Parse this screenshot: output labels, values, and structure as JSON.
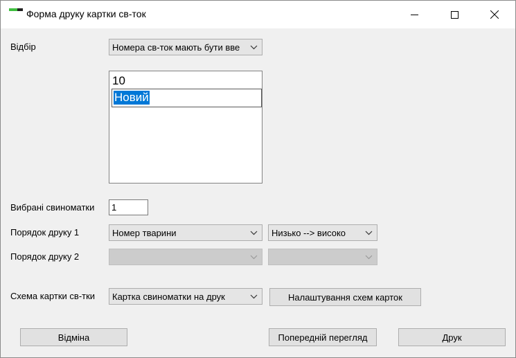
{
  "window": {
    "title": "Форма друку картки св-ток"
  },
  "form": {
    "selection_label": "Відбір",
    "selection_value": "Номера св-ток мають бути вве",
    "list_items": [
      "10"
    ],
    "list_edit_value": "Новий",
    "selected_label": "Вибрані свиноматки",
    "selected_value": "1",
    "order1_label": "Порядок друку 1",
    "order1_field": "Номер тварини",
    "order1_direction": "Низько --> високо",
    "order2_label": "Порядок друку 2",
    "order2_field": "",
    "order2_direction": "",
    "scheme_label": "Схема картки св-тки",
    "scheme_value": "Картка свиноматки на друк",
    "scheme_settings_button": "Налаштування схем карток"
  },
  "buttons": {
    "cancel": "Відміна",
    "preview": "Попередній перегляд",
    "print": "Друк"
  },
  "icons": {
    "combo_arrow": "chevron-down-icon",
    "minimize": "minimize-icon",
    "maximize": "maximize-icon",
    "close": "close-icon"
  },
  "colors": {
    "selection_highlight": "#0078d7",
    "app_icon_green": "#3fbf3f"
  }
}
